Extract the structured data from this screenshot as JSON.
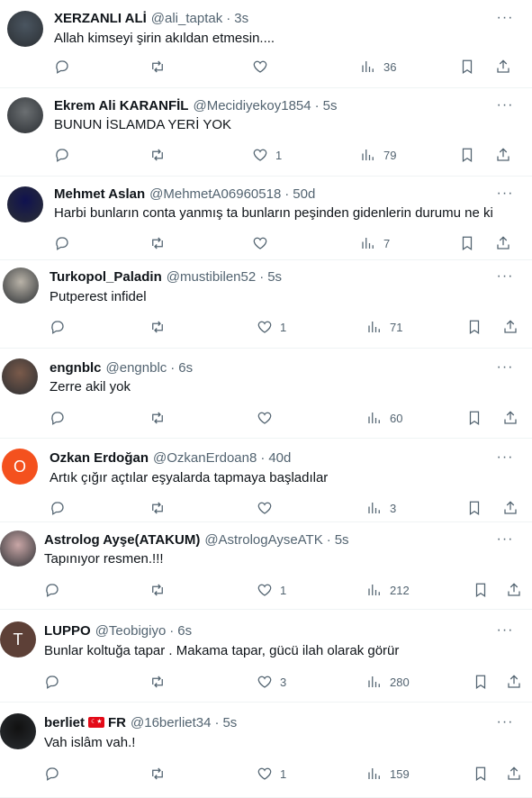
{
  "tweets": [
    {
      "name": "XERZANLI ALİ",
      "handle": "@ali_taptak",
      "time": "3s",
      "text": "Allah kimseyi şirin akıldan etmesin....",
      "likes": "",
      "views": "36",
      "avatar_color": "#4a5560"
    },
    {
      "name": "Ekrem Ali KARANFİL",
      "handle": "@Mecidiyekoy1854",
      "time": "5s",
      "text": "BUNUN İSLAMDA YERİ YOK",
      "likes": "1",
      "views": "79",
      "avatar_color": "#6b6f72"
    },
    {
      "name": "Mehmet Aslan",
      "handle": "@MehmetA06960518",
      "time": "50d",
      "text": "Harbi bunların conta yanmış ta bunların peşinden gidenlerin durumu ne ki",
      "likes": "",
      "views": "7",
      "avatar_color": "#10124f"
    },
    {
      "name": "Turkopol_Paladin",
      "handle": "@mustibilen52",
      "time": "5s",
      "text": "Putperest infidel",
      "likes": "1",
      "views": "71",
      "avatar_color": "#b9b3a8"
    },
    {
      "name": "engnblc",
      "handle": "@engnblc",
      "time": "6s",
      "text": "Zerre akil yok",
      "likes": "",
      "views": "60",
      "avatar_color": "#7a5a4a"
    },
    {
      "name": "Ozkan Erdoğan",
      "handle": "@OzkanErdoan8",
      "time": "40d",
      "text": "Artık çığır açtılar eşyalarda tapmaya başladılar",
      "likes": "",
      "views": "3",
      "avatar_color": "#f4511e",
      "avatar_letter": "O"
    },
    {
      "name": "Astrolog Ayşe(ATAKUM)",
      "handle": "@AstrologAyseATK",
      "time": "5s",
      "text": "Tapınıyor resmen.!!!",
      "likes": "1",
      "views": "212",
      "avatar_color": "#c9a6a6"
    },
    {
      "name": "LUPPO",
      "handle": "@Teobigiyo",
      "time": "6s",
      "text": "Bunlar koltuğa tapar . Makama tapar, gücü ilah olarak görür",
      "likes": "3",
      "views": "280",
      "avatar_color": "#5d4037",
      "avatar_letter": "T"
    },
    {
      "name": "berliet",
      "name_suffix": "FR",
      "handle": "@16berliet34",
      "time": "5s",
      "text": "Vah islâm vah.!",
      "likes": "1",
      "views": "159",
      "avatar_color": "#111111"
    }
  ],
  "dot": "·",
  "more": "···"
}
